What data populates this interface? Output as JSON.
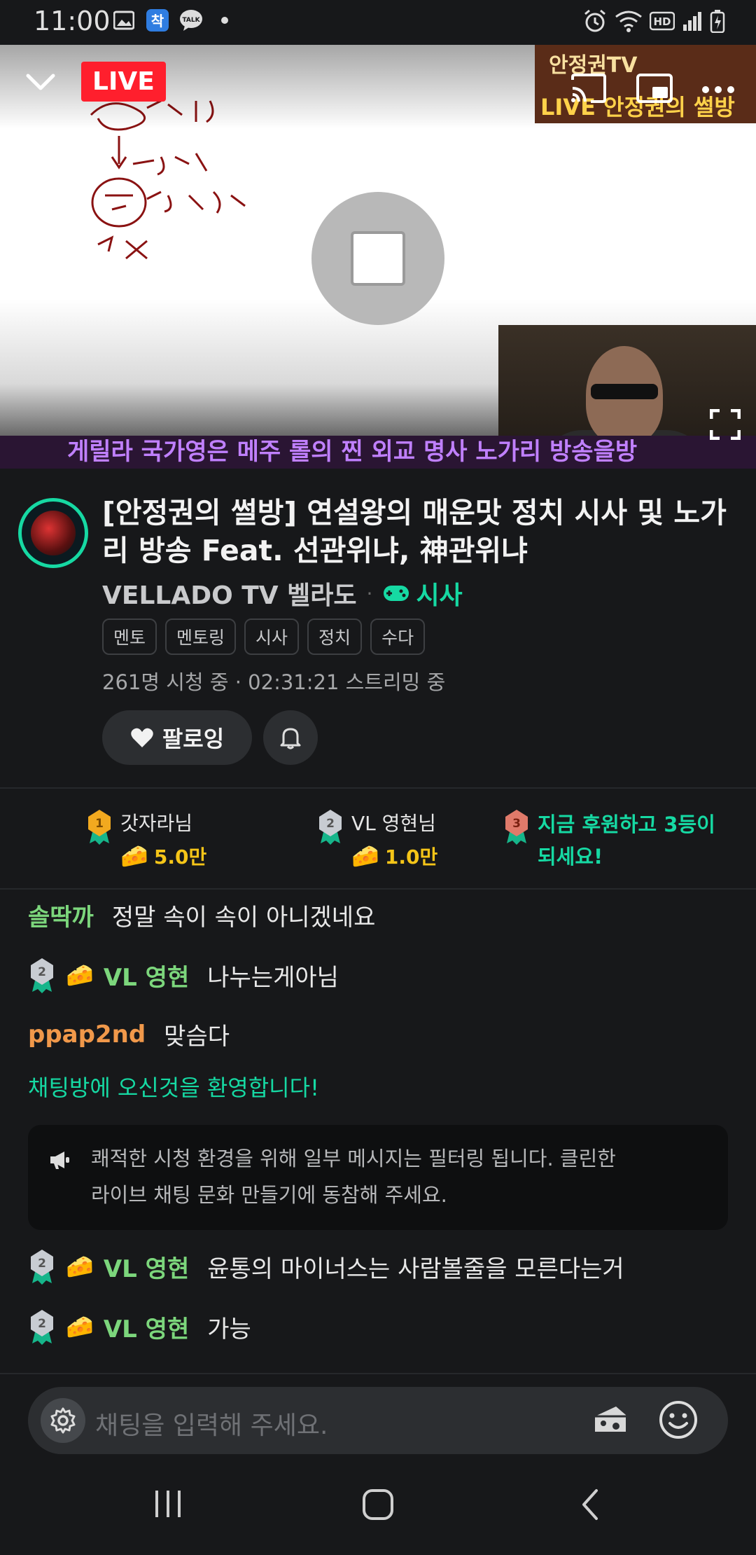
{
  "status_bar": {
    "time": "11:00",
    "left_icons": [
      "image-icon",
      "app-badge-icon",
      "kakaotalk-icon",
      "dot-icon"
    ],
    "right_icons": [
      "alarm-icon",
      "wifi-icon",
      "hd-icon",
      "signal-icon",
      "battery-icon"
    ],
    "hd_label": "HD"
  },
  "player": {
    "live_label": "LIVE",
    "ticker_text": "게릴라 국가영은 메주 롤의 찐 외교 명사 노가리 방송을방",
    "overlay_top": "안정권TV",
    "overlay_bottom": "LIVE 안정권의 썰방"
  },
  "stream": {
    "title": "[안정권의 썰방] 연설왕의 매운맛 정치 시사 및 노가리 방송 Feat. 선관위냐, 神관위냐",
    "channel_name": "VELLADO TV 벨라도",
    "category": "시사",
    "tags": [
      "멘토",
      "멘토링",
      "시사",
      "정치",
      "수다"
    ],
    "viewers": "261명 시청 중",
    "uptime": "02:31:21 스트리밍 중",
    "follow_label": "팔로잉"
  },
  "ranking": {
    "first": {
      "rank": "1",
      "name": "갓자라님",
      "amount": "5.0만"
    },
    "second": {
      "rank": "2",
      "name": "VL 영현님",
      "amount": "1.0만"
    },
    "third": {
      "rank": "3",
      "cta_line1": "지금 후원하고 3등이",
      "cta_line2": "되세요!"
    }
  },
  "chat": {
    "messages": [
      {
        "user": "솔딱까",
        "text": "정말 속이 속이 아니겠네요"
      },
      {
        "user": "VL 영현",
        "text": "나누는게아님"
      },
      {
        "user": "ppap2nd",
        "text": "맞슴다"
      },
      {
        "user": "VL 영현",
        "text": "윤통의 마이너스는 사람볼줄을 모른다는거"
      },
      {
        "user": "VL 영현",
        "text": "가능"
      }
    ],
    "welcome": "채팅방에 오신것을 환영합니다!",
    "notice_line1": "쾌적한 시청 환경을 위해 일부 메시지는 필터링 됩니다. 클린한",
    "notice_line2": "라이브 채팅 문화 만들기에 동참해 주세요.",
    "input_placeholder": "채팅을 입력해 주세요."
  },
  "colors": {
    "accent": "#16d9a3",
    "live": "#ff1f2d",
    "background": "#17181a",
    "cheese": "#f5c518"
  }
}
